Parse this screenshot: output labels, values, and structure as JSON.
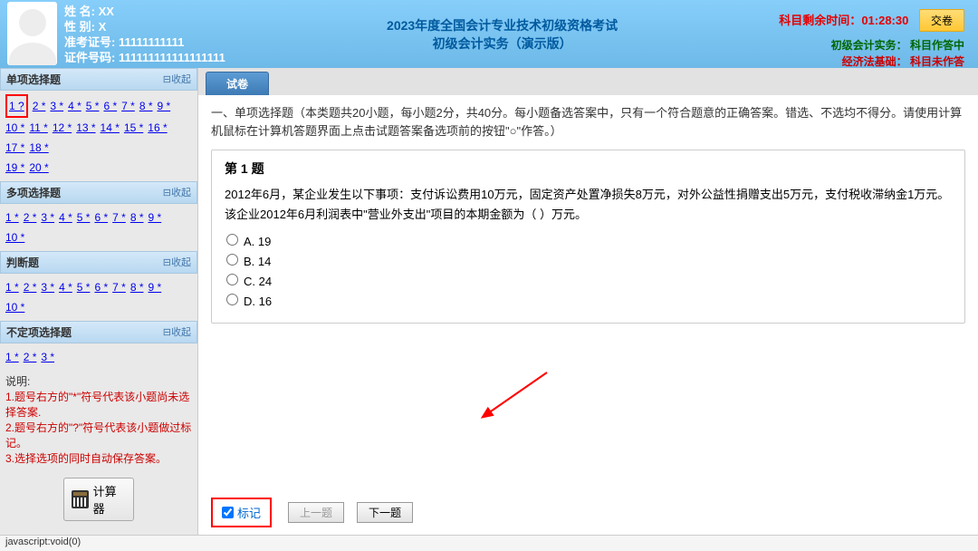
{
  "user": {
    "name_label": "姓    名:",
    "name_value": "XX",
    "gender_label": "性    别:",
    "gender_value": "X",
    "admission_label": "准考证号:",
    "admission_value": "11111111111",
    "id_label": "证件号码:",
    "id_value": "111111111111111111"
  },
  "exam": {
    "title_line1": "2023年度全国会计专业技术初级资格考试",
    "title_line2": "初级会计实务（演示版）"
  },
  "status": {
    "time_label": "科目剩余时间：",
    "time_value": "01:28:30",
    "submit_label": "交卷",
    "subject1_name": "初级会计实务",
    "subject1_status": "：  科目作答中",
    "subject2_name": "经济法基础",
    "subject2_status": "：  科目未作答"
  },
  "sections": {
    "collapse_label": "⊟收起",
    "single": {
      "title": "单项选择题",
      "items": [
        "1 ?",
        "2 *",
        "3 *",
        "4 *",
        "5 *",
        "6 *",
        "7 *",
        "8 *",
        "9 *",
        "10 *",
        "11 *",
        "12 *",
        "13 *",
        "14 *",
        "15 *",
        "16 *",
        "17 *",
        "18 *",
        "19 *",
        "20 *"
      ]
    },
    "multi": {
      "title": "多项选择题",
      "items": [
        "1 *",
        "2 *",
        "3 *",
        "4 *",
        "5 *",
        "6 *",
        "7 *",
        "8 *",
        "9 *",
        "10 *"
      ]
    },
    "judge": {
      "title": "判断题",
      "items": [
        "1 *",
        "2 *",
        "3 *",
        "4 *",
        "5 *",
        "6 *",
        "7 *",
        "8 *",
        "9 *",
        "10 *"
      ]
    },
    "uncertain": {
      "title": "不定项选择题",
      "items": [
        "1 *",
        "2 *",
        "3 *"
      ]
    }
  },
  "instructions": {
    "intro": "说明:",
    "line1": "1.题号右方的\"*\"符号代表该小题尚未选择答案.",
    "line2": "2.题号右方的\"?\"符号代表该小题做过标记。",
    "line3": "3.选择选项的同时自动保存答案。"
  },
  "calculator_label": "计算器",
  "tab_label": "试卷",
  "question": {
    "instruction": "一、单项选择题（本类题共20小题，每小题2分，共40分。每小题备选答案中，只有一个符合题意的正确答案。错选、不选均不得分。请使用计算机鼠标在计算机答题界面上点击试题答案备选项前的按钮\"○\"作答。）",
    "title": "第 1 题",
    "text": "2012年6月，某企业发生以下事项：支付诉讼费用10万元，固定资产处置净损失8万元，对外公益性捐赠支出5万元，支付税收滞纳金1万元。该企业2012年6月利润表中\"营业外支出\"项目的本期金额为（        ）万元。",
    "options": {
      "a": "A.  19",
      "b": "B.  14",
      "c": "C.  24",
      "d": "D.  16"
    }
  },
  "buttons": {
    "mark": "标记",
    "prev": "上一题",
    "next": "下一题"
  },
  "statusbar_text": "javascript:void(0)"
}
